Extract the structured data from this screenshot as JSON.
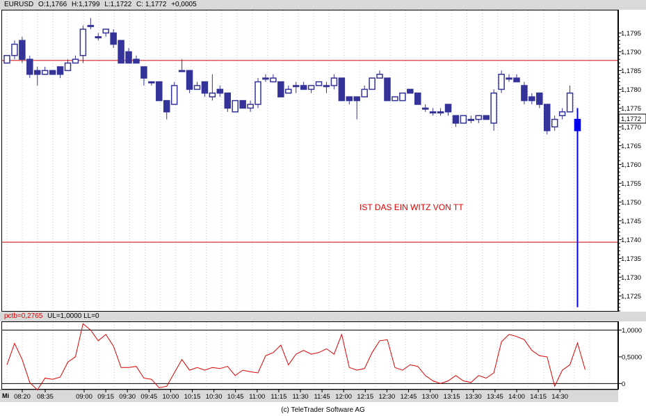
{
  "header": {
    "symbol": "EURUSD",
    "open": "O:1,1766",
    "high": "H:1,1799",
    "low": "L:1,1722",
    "close": "C: 1,1772",
    "change": "+0,0005"
  },
  "indicator_header": {
    "name": "pctb=0,2765",
    "params": "UL=1,0000 LL=0"
  },
  "day_label": "Mi",
  "annotation": "IST DAS EIN WITZ VON TT",
  "last_price_label": "1,1772",
  "copyright": "(c) TeleTrader Software AG",
  "colors": {
    "candle": "#333399",
    "hline": "#cc0000",
    "indicator": "#dd0000",
    "grid": "#c8c8e0",
    "header_bg": "#d9d9d9"
  },
  "chart_data": [
    {
      "type": "candlestick",
      "ylim": [
        1.1721,
        1.1801
      ],
      "y_ticks": [
        "1,1795",
        "1,1790",
        "1,1785",
        "1,1780",
        "1,1775",
        "1,1770",
        "1,1765",
        "1,1760",
        "1,1755",
        "1,1750",
        "1,1745",
        "1,1740",
        "1,1735",
        "1,1730",
        "1,1725"
      ],
      "y_tick_values": [
        1.1795,
        1.179,
        1.1785,
        1.178,
        1.1775,
        1.177,
        1.1765,
        1.176,
        1.1755,
        1.175,
        1.1745,
        1.174,
        1.1735,
        1.173,
        1.1725
      ],
      "x_ticks": [
        "08:20",
        "08:35",
        "09:00",
        "09:15",
        "09:30",
        "09:45",
        "10:00",
        "10:15",
        "10:30",
        "10:45",
        "11:00",
        "11:15",
        "11:30",
        "11:45",
        "12:00",
        "12:15",
        "12:30",
        "12:45",
        "13:00",
        "13:15",
        "13:30",
        "13:45",
        "14:00",
        "14:15",
        "14:30"
      ],
      "horizontal_lines": [
        1.17877,
        1.17393
      ],
      "candles": [
        {
          "o": 1.1787,
          "h": 1.1789,
          "l": 1.1787,
          "c": 1.1789
        },
        {
          "o": 1.1789,
          "h": 1.1793,
          "l": 1.1788,
          "c": 1.1792
        },
        {
          "o": 1.1793,
          "h": 1.1794,
          "l": 1.1787,
          "c": 1.1788
        },
        {
          "o": 1.1788,
          "h": 1.1789,
          "l": 1.1783,
          "c": 1.1784
        },
        {
          "o": 1.1785,
          "h": 1.1786,
          "l": 1.1781,
          "c": 1.1784
        },
        {
          "o": 1.1784,
          "h": 1.1786,
          "l": 1.1784,
          "c": 1.1785
        },
        {
          "o": 1.1785,
          "h": 1.1785,
          "l": 1.1784,
          "c": 1.1784
        },
        {
          "o": 1.1786,
          "h": 1.1786,
          "l": 1.1783,
          "c": 1.1784
        },
        {
          "o": 1.1785,
          "h": 1.1788,
          "l": 1.1785,
          "c": 1.1787
        },
        {
          "o": 1.1787,
          "h": 1.1789,
          "l": 1.1787,
          "c": 1.1788
        },
        {
          "o": 1.1789,
          "h": 1.1797,
          "l": 1.1787,
          "c": 1.1796
        },
        {
          "o": 1.1797,
          "h": 1.1799,
          "l": 1.1796,
          "c": 1.1797
        },
        {
          "o": 1.1794,
          "h": 1.1795,
          "l": 1.1793,
          "c": 1.1794
        },
        {
          "o": 1.1795,
          "h": 1.1796,
          "l": 1.1794,
          "c": 1.1796
        },
        {
          "o": 1.1795,
          "h": 1.1796,
          "l": 1.1791,
          "c": 1.1792
        },
        {
          "o": 1.1793,
          "h": 1.1793,
          "l": 1.1787,
          "c": 1.1787
        },
        {
          "o": 1.179,
          "h": 1.1791,
          "l": 1.1787,
          "c": 1.1787
        },
        {
          "o": 1.1788,
          "h": 1.1789,
          "l": 1.1787,
          "c": 1.1787
        },
        {
          "o": 1.1786,
          "h": 1.1786,
          "l": 1.1781,
          "c": 1.1783
        },
        {
          "o": 1.1782,
          "h": 1.1782,
          "l": 1.1781,
          "c": 1.1782
        },
        {
          "o": 1.1782,
          "h": 1.1782,
          "l": 1.1777,
          "c": 1.1777
        },
        {
          "o": 1.1777,
          "h": 1.1777,
          "l": 1.1772,
          "c": 1.1774
        },
        {
          "o": 1.1776,
          "h": 1.1782,
          "l": 1.1776,
          "c": 1.1781
        },
        {
          "o": 1.1785,
          "h": 1.1788,
          "l": 1.1785,
          "c": 1.1785
        },
        {
          "o": 1.1785,
          "h": 1.1785,
          "l": 1.1779,
          "c": 1.178
        },
        {
          "o": 1.178,
          "h": 1.1782,
          "l": 1.178,
          "c": 1.1781
        },
        {
          "o": 1.1782,
          "h": 1.1782,
          "l": 1.1778,
          "c": 1.1779
        },
        {
          "o": 1.1778,
          "h": 1.1784,
          "l": 1.1777,
          "c": 1.1779
        },
        {
          "o": 1.178,
          "h": 1.1781,
          "l": 1.1778,
          "c": 1.1779
        },
        {
          "o": 1.1779,
          "h": 1.1779,
          "l": 1.1774,
          "c": 1.1775
        },
        {
          "o": 1.1774,
          "h": 1.1777,
          "l": 1.1774,
          "c": 1.1777
        },
        {
          "o": 1.1777,
          "h": 1.1777,
          "l": 1.1775,
          "c": 1.1775
        },
        {
          "o": 1.1775,
          "h": 1.1777,
          "l": 1.1774,
          "c": 1.1776
        },
        {
          "o": 1.1776,
          "h": 1.1783,
          "l": 1.1775,
          "c": 1.1782
        },
        {
          "o": 1.1783,
          "h": 1.1784,
          "l": 1.1782,
          "c": 1.1783
        },
        {
          "o": 1.1782,
          "h": 1.1784,
          "l": 1.1782,
          "c": 1.1783
        },
        {
          "o": 1.1782,
          "h": 1.1782,
          "l": 1.1778,
          "c": 1.1778
        },
        {
          "o": 1.1779,
          "h": 1.1781,
          "l": 1.1779,
          "c": 1.178
        },
        {
          "o": 1.1781,
          "h": 1.1782,
          "l": 1.1779,
          "c": 1.1781
        },
        {
          "o": 1.1781,
          "h": 1.1782,
          "l": 1.178,
          "c": 1.178
        },
        {
          "o": 1.178,
          "h": 1.1781,
          "l": 1.1779,
          "c": 1.1781
        },
        {
          "o": 1.1781,
          "h": 1.1782,
          "l": 1.1781,
          "c": 1.1782
        },
        {
          "o": 1.1781,
          "h": 1.1782,
          "l": 1.1779,
          "c": 1.1781
        },
        {
          "o": 1.1781,
          "h": 1.1784,
          "l": 1.178,
          "c": 1.1783
        },
        {
          "o": 1.1783,
          "h": 1.1783,
          "l": 1.1777,
          "c": 1.1777
        },
        {
          "o": 1.1778,
          "h": 1.1778,
          "l": 1.1776,
          "c": 1.1777
        },
        {
          "o": 1.1778,
          "h": 1.1778,
          "l": 1.1772,
          "c": 1.1777
        },
        {
          "o": 1.1778,
          "h": 1.1781,
          "l": 1.1778,
          "c": 1.178
        },
        {
          "o": 1.178,
          "h": 1.1783,
          "l": 1.178,
          "c": 1.1783
        },
        {
          "o": 1.1783,
          "h": 1.1785,
          "l": 1.1783,
          "c": 1.1784
        },
        {
          "o": 1.1783,
          "h": 1.1783,
          "l": 1.1777,
          "c": 1.1777
        },
        {
          "o": 1.1777,
          "h": 1.1778,
          "l": 1.1777,
          "c": 1.1778
        },
        {
          "o": 1.1777,
          "h": 1.1779,
          "l": 1.1777,
          "c": 1.1779
        },
        {
          "o": 1.178,
          "h": 1.178,
          "l": 1.1779,
          "c": 1.1779
        },
        {
          "o": 1.1779,
          "h": 1.1779,
          "l": 1.1776,
          "c": 1.1776
        },
        {
          "o": 1.1775,
          "h": 1.1776,
          "l": 1.1774,
          "c": 1.1775
        },
        {
          "o": 1.1774,
          "h": 1.1775,
          "l": 1.1773,
          "c": 1.1774
        },
        {
          "o": 1.1774,
          "h": 1.1775,
          "l": 1.1773,
          "c": 1.1774
        },
        {
          "o": 1.1776,
          "h": 1.1776,
          "l": 1.1773,
          "c": 1.1774
        },
        {
          "o": 1.1773,
          "h": 1.1773,
          "l": 1.177,
          "c": 1.1771
        },
        {
          "o": 1.1771,
          "h": 1.1773,
          "l": 1.1771,
          "c": 1.1773
        },
        {
          "o": 1.1772,
          "h": 1.1773,
          "l": 1.1771,
          "c": 1.1772
        },
        {
          "o": 1.1772,
          "h": 1.1773,
          "l": 1.1771,
          "c": 1.1773
        },
        {
          "o": 1.1773,
          "h": 1.1773,
          "l": 1.1772,
          "c": 1.1772
        },
        {
          "o": 1.1771,
          "h": 1.178,
          "l": 1.1769,
          "c": 1.1779
        },
        {
          "o": 1.178,
          "h": 1.1785,
          "l": 1.1779,
          "c": 1.1784
        },
        {
          "o": 1.1783,
          "h": 1.1784,
          "l": 1.1782,
          "c": 1.1783
        },
        {
          "o": 1.1783,
          "h": 1.1784,
          "l": 1.1782,
          "c": 1.1782
        },
        {
          "o": 1.1781,
          "h": 1.1782,
          "l": 1.1776,
          "c": 1.1777
        },
        {
          "o": 1.1778,
          "h": 1.1779,
          "l": 1.1776,
          "c": 1.1777
        },
        {
          "o": 1.1779,
          "h": 1.1779,
          "l": 1.1775,
          "c": 1.1776
        },
        {
          "o": 1.1776,
          "h": 1.1776,
          "l": 1.1768,
          "c": 1.1769
        },
        {
          "o": 1.177,
          "h": 1.1773,
          "l": 1.1769,
          "c": 1.1772
        },
        {
          "o": 1.1773,
          "h": 1.1775,
          "l": 1.1772,
          "c": 1.1774
        },
        {
          "o": 1.1774,
          "h": 1.1781,
          "l": 1.1774,
          "c": 1.1779
        },
        {
          "o": 1.1772,
          "h": 1.1775,
          "l": 1.1722,
          "c": 1.1769
        }
      ]
    },
    {
      "type": "line",
      "name": "pctb",
      "ylim": [
        -0.1,
        1.15
      ],
      "y_ticks": [
        "1,0000",
        "0,5000",
        "0"
      ],
      "y_tick_values": [
        1.0,
        0.5,
        0.0
      ],
      "horizontal_lines": [
        1.0,
        0.0
      ],
      "values": [
        0.35,
        0.75,
        0.45,
        0.02,
        -0.12,
        0.1,
        0.08,
        0.12,
        0.4,
        0.5,
        1.12,
        1.0,
        0.8,
        0.92,
        0.7,
        0.3,
        0.3,
        0.32,
        0.1,
        0.08,
        -0.08,
        -0.05,
        0.2,
        0.45,
        0.25,
        0.3,
        0.25,
        0.3,
        0.28,
        0.32,
        0.15,
        0.25,
        0.22,
        0.2,
        0.52,
        0.58,
        0.72,
        0.35,
        0.55,
        0.62,
        0.55,
        0.58,
        0.65,
        0.55,
        0.92,
        0.3,
        0.25,
        0.28,
        0.58,
        0.8,
        0.82,
        0.3,
        0.25,
        0.35,
        0.32,
        0.15,
        0.05,
        0.0,
        0.05,
        0.15,
        0.05,
        0.02,
        0.15,
        0.1,
        0.2,
        0.78,
        0.92,
        0.88,
        0.82,
        0.62,
        0.52,
        0.5,
        -0.05,
        0.25,
        0.35,
        0.76,
        0.26
      ]
    }
  ]
}
